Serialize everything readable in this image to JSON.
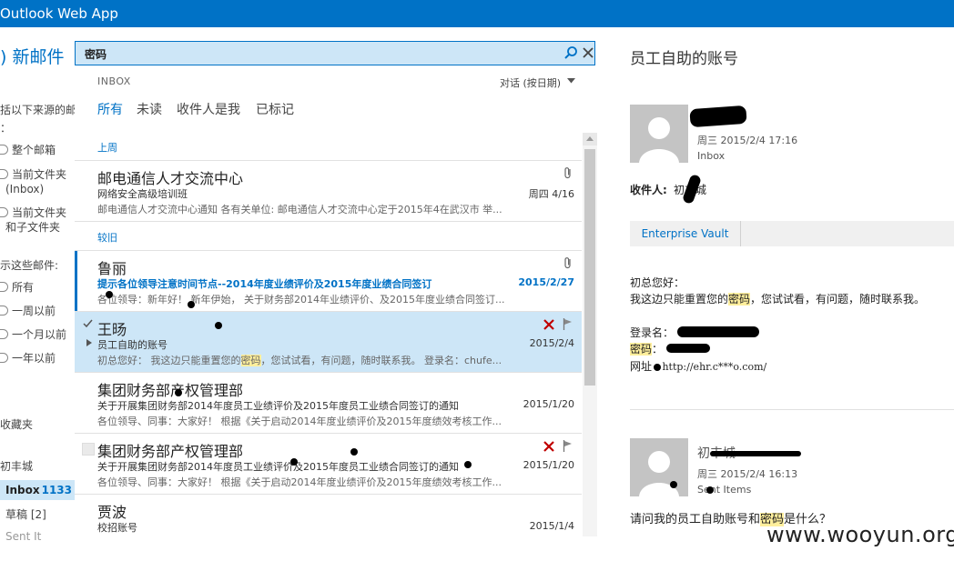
{
  "app": {
    "title": "Outlook Web App"
  },
  "left": {
    "new_mail": ") 新邮件",
    "filter_title": "括以下来源的邮",
    "filter_colon": "：",
    "scope": [
      {
        "label": "整个邮箱"
      },
      {
        "label": "当前文件夹",
        "sub": "(Inbox)"
      },
      {
        "label": "当前文件夹",
        "sub": "和子文件夹"
      }
    ],
    "show_title": "示这些邮件:",
    "time": [
      {
        "label": "所有"
      },
      {
        "label": "一周以前"
      },
      {
        "label": "一个月以前"
      },
      {
        "label": "一年以前"
      }
    ],
    "favorites": "收藏夹",
    "account": "初丰城",
    "inbox": {
      "name": "Inbox",
      "count": "1133"
    },
    "drafts": "草稿 [2]",
    "sent": "Sent It"
  },
  "search": {
    "value": "密码"
  },
  "list_header": {
    "folder": "INBOX",
    "sort": "对话 (按日期)",
    "tabs": [
      "所有",
      "未读",
      "收件人是我",
      "已标记"
    ]
  },
  "groups": [
    "上周",
    "较旧"
  ],
  "messages": [
    {
      "sender": "邮电通信人才交流中心",
      "subject": "网络安全高级培训班",
      "preview": "邮电通信人才交流中心通知 各有关单位: 邮电通信人才交流中心定于2015年4在武汉市 举...",
      "date": "周四 4/16"
    },
    {
      "sender": "鲁丽",
      "subject": "提示各位领导注意时间节点--2014年度业绩评价及2015年度业绩合同签订",
      "preview": "各位领导：新年好！ 新年伊始， 关于财务部2014年业绩评价、及2015年度业绩合同签订...",
      "date": "2015/2/27"
    },
    {
      "sender": "王旸",
      "subject": "员工自助的账号",
      "preview_pre": "初总您好： 我这边只能重置您的",
      "preview_hl": "密码",
      "preview_post": "，您试试看，有问题，随时联系我。 登录名：chufe...",
      "date": "2015/2/4"
    },
    {
      "sender": "集团财务部产权管理部",
      "subject": "关于开展集团财务部2014年度员工业绩评价及2015年度员工业绩合同签订的通知",
      "preview": "各位领导、同事：大家好！ 根据《关于启动2014年度业绩评价及2015年度绩效考核工作...",
      "date": "2015/1/20"
    },
    {
      "sender": "集团财务部产权管理部",
      "subject": "关于开展集团财务部2014年度员工业绩评价及2015年度员工业绩合同签订的通知",
      "preview": "各位领导、同事：大家好！ 根据《关于启动2014年度业绩评价及2015年度绩效考核工作...",
      "date": "2015/1/20"
    },
    {
      "sender": "贾波",
      "subject": "校招账号",
      "preview": "",
      "date": "2015/1/4"
    }
  ],
  "reading": {
    "title": "员工自助的账号",
    "msg1": {
      "datetime": "周三 2015/2/4 17:16",
      "folder": "Inbox"
    },
    "to_label": "收件人:",
    "to_value": "初丰城",
    "vault": "Enterprise Vault",
    "greeting": "初总您好：",
    "line_pre": "我这边只能重置您的",
    "line_hl": "密码",
    "line_post": "，您试试看，有问题，随时联系我。",
    "login_label": "登录名：",
    "pwd_label": "密码",
    "pwd_colon": "：",
    "url_label": "网址",
    "url_value": "http://ehr.c***o.com/",
    "msg2": {
      "sender": "初丰城",
      "datetime": "周三 2015/2/4 16:13",
      "folder": "Sent Items"
    },
    "question_pre": "请问我的员工自助账号和",
    "question_hl": "密码",
    "question_post": "是什么？"
  },
  "watermark": "www.wooyun.org",
  "colors": {
    "brand": "#0072c6",
    "selected": "#cde6f7",
    "highlight": "#ffef9c",
    "delete": "#c00000"
  }
}
